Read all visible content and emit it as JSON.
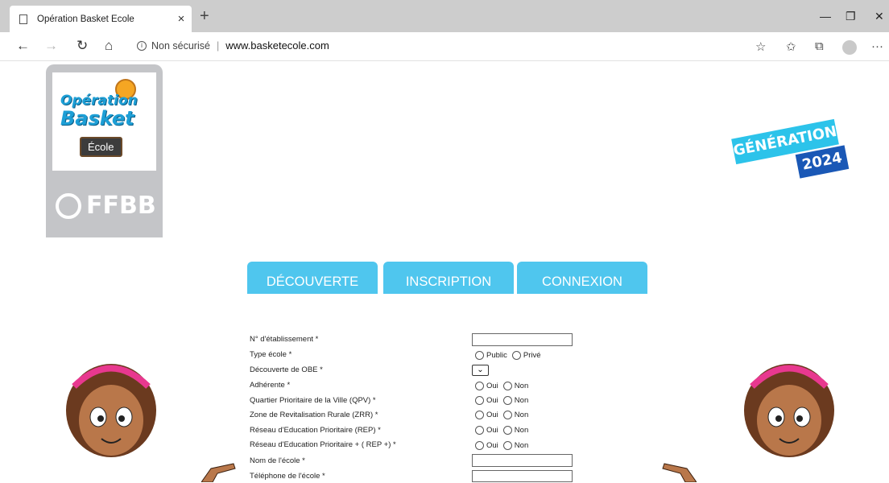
{
  "browser": {
    "tab_title": "Opération Basket Ecole",
    "tab_close": "×",
    "new_tab": "+",
    "security_label": "Non sécurisé",
    "url": "www.basketecole.com",
    "win_minimize": "—",
    "win_restore": "❐",
    "win_close": "✕",
    "nav_back": "←",
    "nav_forward": "→",
    "nav_refresh": "↻",
    "nav_home": "⌂",
    "fav_star": "☆",
    "favorites": "✩",
    "collections": "⧉",
    "more": "···"
  },
  "logo": {
    "obe_line1": "Opération",
    "obe_line2": "Basket",
    "obe_ecole": "École",
    "ffbb": "FFBB"
  },
  "generation": {
    "line1": "GÉNÉRATION",
    "line2": "2024"
  },
  "nav": [
    {
      "label": "DÉCOUVERTE"
    },
    {
      "label": "INSCRIPTION"
    },
    {
      "label": "CONNEXION"
    }
  ],
  "form": {
    "fields": [
      {
        "label": "N° d'établissement *",
        "type": "text"
      },
      {
        "label": "Type école *",
        "type": "radio",
        "options": [
          "Public",
          "Privé"
        ]
      },
      {
        "label": "Découverte de OBE *",
        "type": "select"
      },
      {
        "label": "Adhérente *",
        "type": "radio",
        "options": [
          "Oui",
          "Non"
        ]
      },
      {
        "label": "Quartier Prioritaire de la Ville (QPV) *",
        "type": "radio",
        "options": [
          "Oui",
          "Non"
        ]
      },
      {
        "label": "Zone de Revitalisation Rurale (ZRR) *",
        "type": "radio",
        "options": [
          "Oui",
          "Non"
        ]
      },
      {
        "label": "Réseau d'Education Prioritaire (REP) *",
        "type": "radio",
        "options": [
          "Oui",
          "Non"
        ]
      },
      {
        "label": "Réseau d'Education Prioritaire + ( REP +) *",
        "type": "radio",
        "options": [
          "Oui",
          "Non"
        ]
      },
      {
        "label": "Nom de l'école *",
        "type": "text"
      },
      {
        "label": "Téléphone de l'école *",
        "type": "text"
      }
    ],
    "select_chevron": "⌄"
  },
  "colors": {
    "nav_pill": "#4fc6ee",
    "logo_panel": "#c4c5c8",
    "gen_cyan": "#2cc3ea",
    "gen_blue": "#1a58b6"
  }
}
